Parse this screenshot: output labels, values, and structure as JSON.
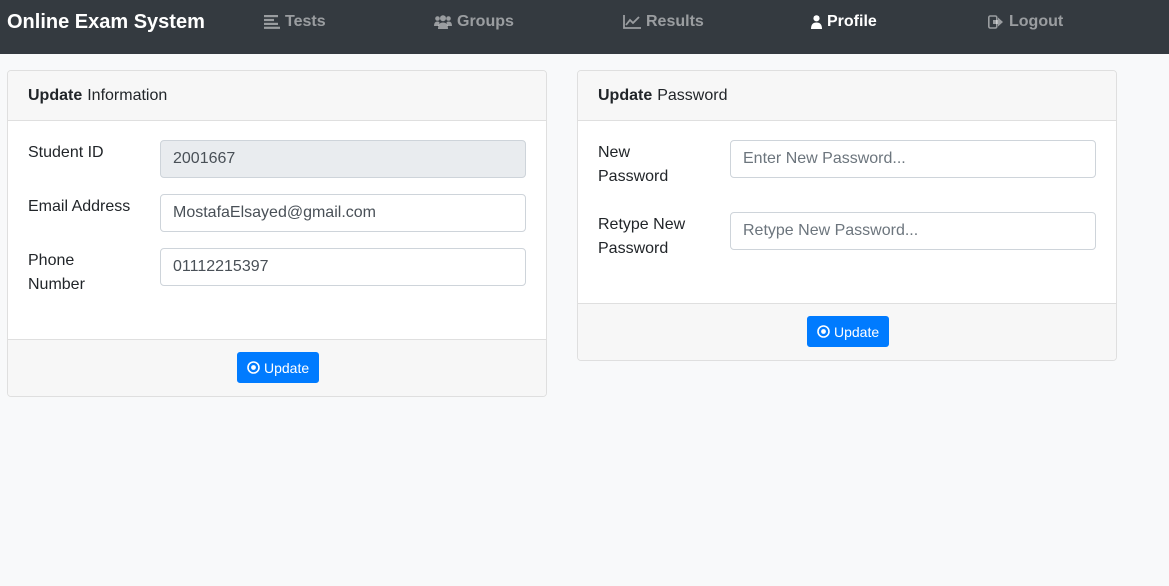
{
  "navbar": {
    "brand": "Online Exam System",
    "items": [
      {
        "label": "Tests",
        "icon": "list-icon"
      },
      {
        "label": "Groups",
        "icon": "users-icon"
      },
      {
        "label": "Results",
        "icon": "line-chart-icon"
      },
      {
        "label": "Profile",
        "icon": "user-icon",
        "active": true
      },
      {
        "label": "Logout",
        "icon": "sign-out-icon"
      }
    ]
  },
  "info_card": {
    "title_bold": "Update",
    "title_rest": "Information",
    "fields": [
      {
        "label": "Student ID",
        "value": "2001667",
        "readonly": true
      },
      {
        "label": "Email Address",
        "value": "MostafaElsayed@gmail.com"
      },
      {
        "label_line1": "Phone",
        "label_line2": "Number",
        "value": "01112215397"
      }
    ],
    "button": "Update"
  },
  "password_card": {
    "title_bold": "Update",
    "title_rest": "Password",
    "fields": [
      {
        "label_line1": "New",
        "label_line2": "Password",
        "placeholder": "Enter New Password..."
      },
      {
        "label_line1": "Retype New",
        "label_line2": "Password",
        "placeholder": "Retype New Password..."
      }
    ],
    "button": "Update"
  },
  "colors": {
    "navbar_bg": "#343a40",
    "page_bg": "#f8f9fa",
    "primary": "#007bff"
  }
}
